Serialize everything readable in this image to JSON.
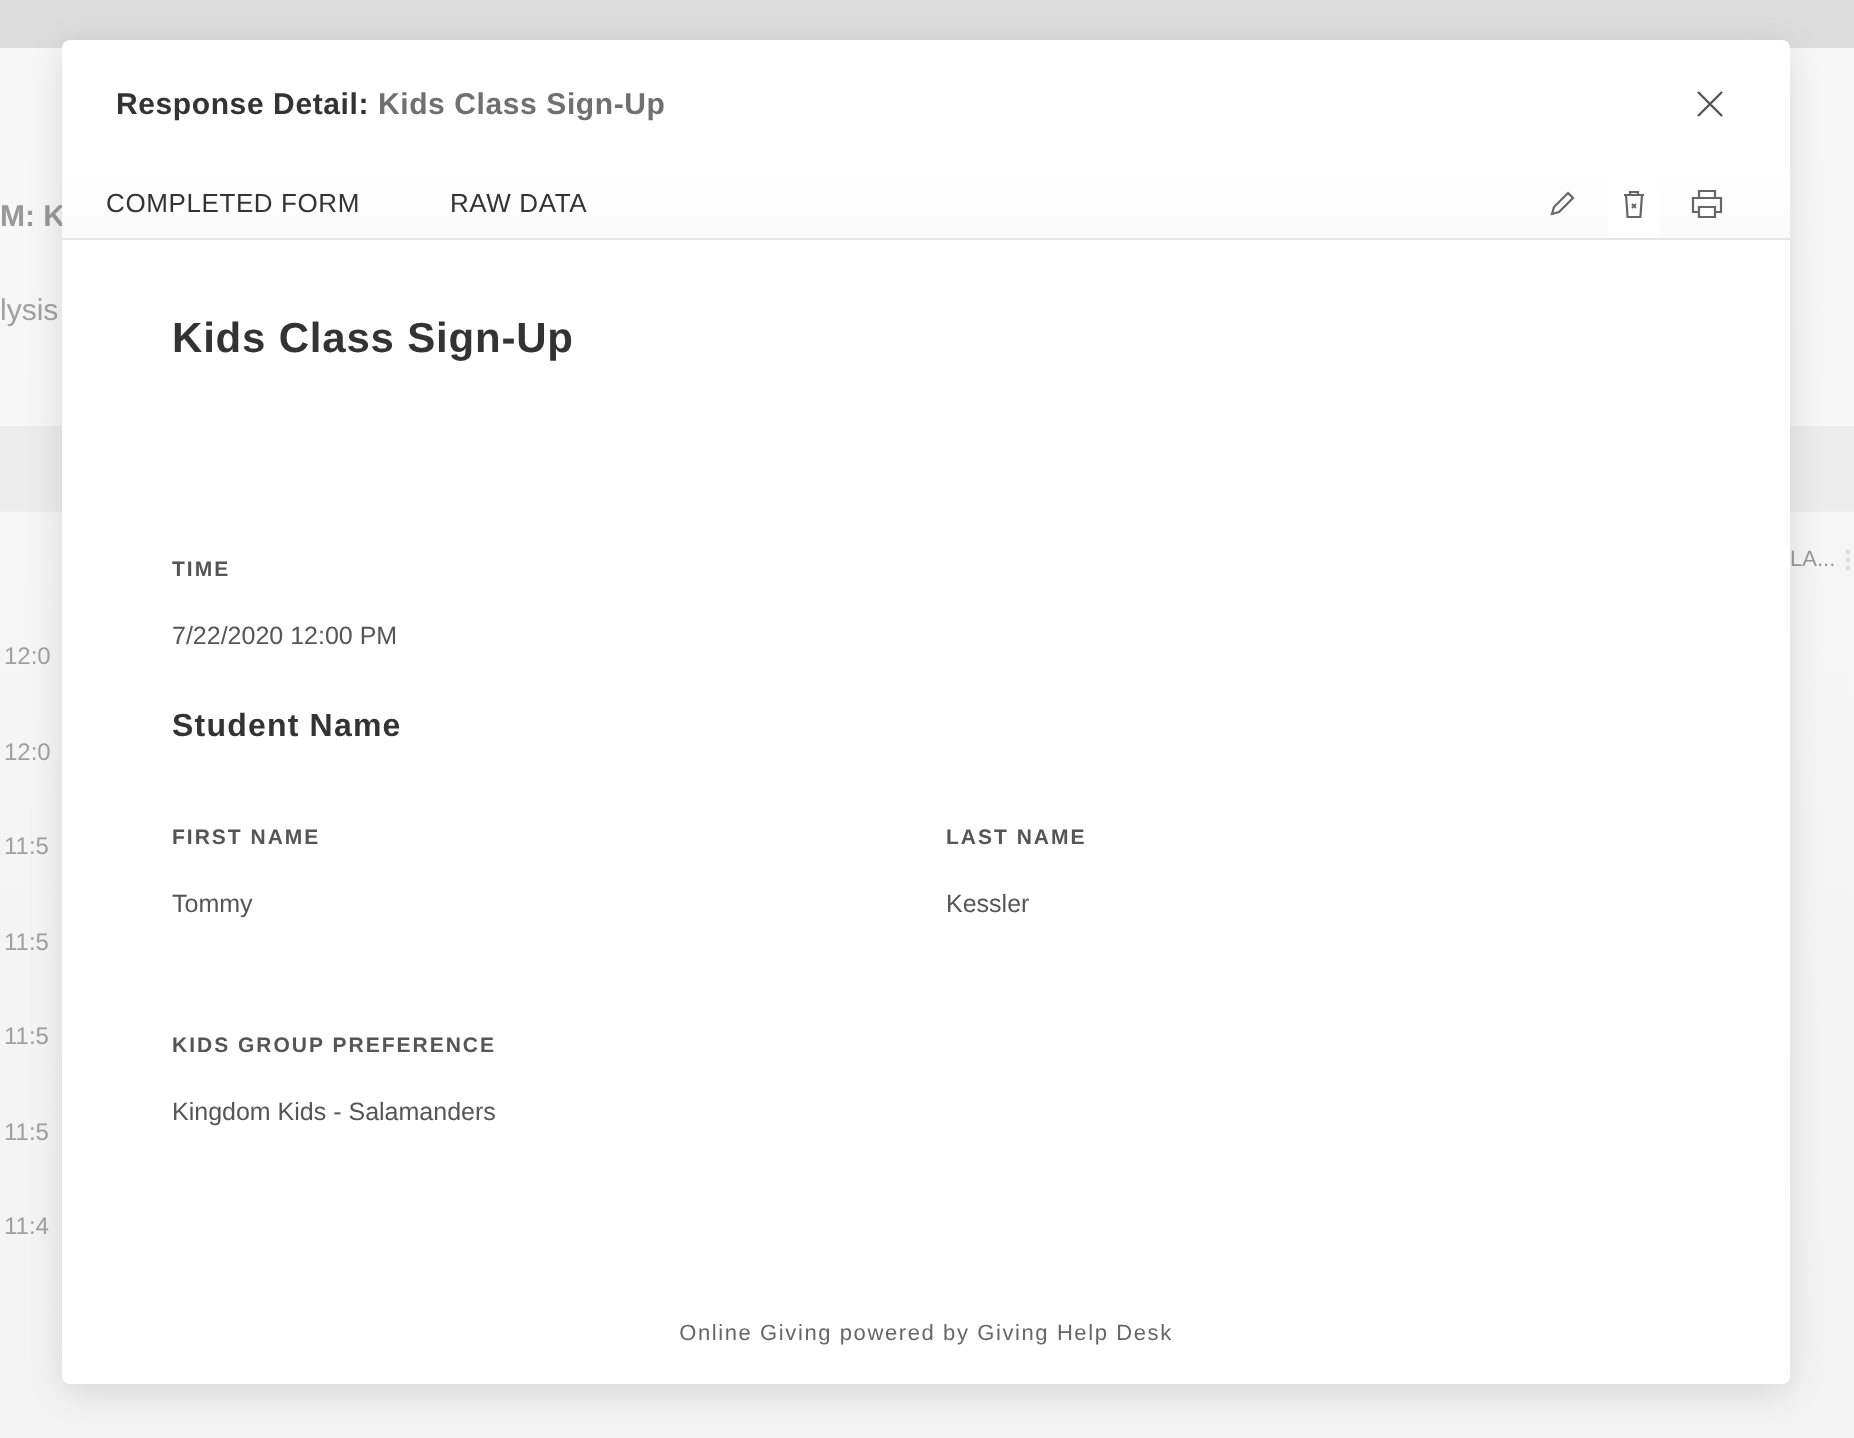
{
  "background": {
    "heading": "M: K",
    "subheading": "lysis",
    "times": [
      "12:0",
      "12:0",
      "11:5",
      "11:5",
      "11:5",
      "11:5",
      "11:4"
    ],
    "column_fragment": "LA..."
  },
  "dialog": {
    "title_label": "Response Detail:",
    "title_value": "Kids Class Sign-Up",
    "tabs": [
      "COMPLETED FORM",
      "RAW DATA"
    ],
    "form_title": "Kids Class Sign-Up",
    "items": [
      {
        "kind": "field",
        "label": "TIME",
        "value": "7/22/2020 12:00 PM"
      },
      {
        "kind": "section",
        "title": "Student Name"
      },
      {
        "kind": "pair",
        "fields": [
          {
            "label": "FIRST NAME",
            "value": "Tommy"
          },
          {
            "label": "LAST NAME",
            "value": "Kessler"
          }
        ]
      },
      {
        "kind": "field",
        "label": "KIDS GROUP PREFERENCE",
        "value": "Kingdom Kids - Salamanders"
      }
    ],
    "footer": "Online Giving powered by Giving Help Desk"
  }
}
